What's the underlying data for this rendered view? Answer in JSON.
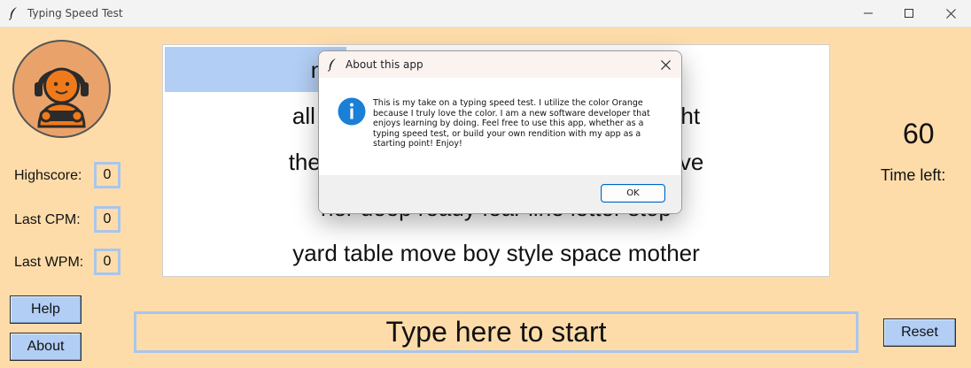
{
  "window": {
    "title": "Typing Speed Test"
  },
  "stats": {
    "highscore_label": "Highscore:",
    "highscore_value": "0",
    "last_cpm_label": "Last CPM:",
    "last_cpm_value": "0",
    "last_wpm_label": "Last WPM:",
    "last_wpm_value": "0"
  },
  "buttons": {
    "help": "Help",
    "about": "About",
    "reset": "Reset"
  },
  "words": {
    "lines": [
      {
        "left": "ne",
        "right": "n"
      },
      {
        "left": "all l",
        "right": "ght"
      },
      {
        "left": "the",
        "right": "ve"
      },
      {
        "left": "her deep ready fear line letter stop",
        "right": ""
      },
      {
        "left": "yard table move boy style space mother",
        "right": ""
      }
    ]
  },
  "timer": {
    "value": "60",
    "label": "Time left:"
  },
  "type_input": {
    "text": "Type here to start"
  },
  "dialog": {
    "title": "About this app",
    "message": "This is my take on a typing speed test. I utilize the color Orange because I truly love the color. I am a new software developer that enjoys learning by doing. Feel free to use this app, whether as a typing speed test, or build your own rendition with my app as a starting point! Enjoy!",
    "ok_label": "OK"
  },
  "colors": {
    "background": "#fedcaa",
    "button": "#b2cef4",
    "highlight": "#b2cef4",
    "border_accent": "#a8c6ec",
    "dialog_button_border": "#0067c0",
    "info_icon": "#1a7fd6"
  }
}
